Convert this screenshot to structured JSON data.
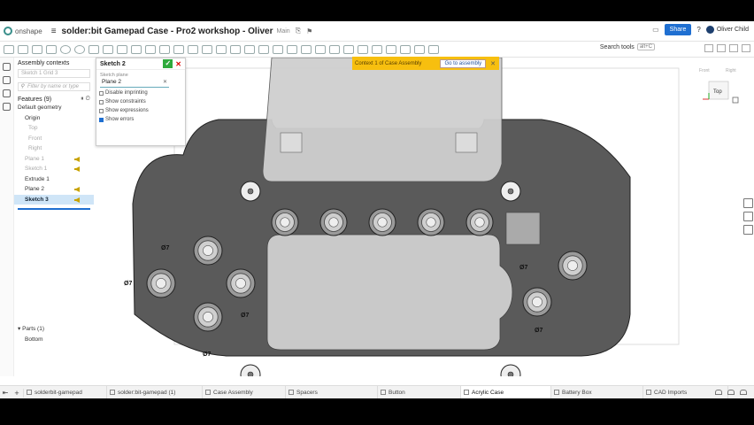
{
  "app": {
    "logo_text": "onshape",
    "title": "solder:bit Gamepad Case - Pro2 workshop - Oliver",
    "branch": "Main"
  },
  "header": {
    "share_label": "Share",
    "help_label": "?",
    "user_name": "Oliver Child"
  },
  "toolbar": {
    "search_tools_label": "Search tools",
    "search_tools_shortcut": "alt+C"
  },
  "feature_panel": {
    "assembly_contexts_title": "Assembly contexts",
    "assembly_context_value": "Sketch 1  Grid 3",
    "filter_placeholder": "Filter by name or type",
    "features_label": "Features (9)",
    "items": [
      {
        "label": "Default geometry",
        "indent": 0,
        "state": "normal",
        "arrow": false
      },
      {
        "label": "Origin",
        "indent": 1,
        "state": "normal",
        "arrow": false
      },
      {
        "label": "Top",
        "indent": 2,
        "state": "dim",
        "arrow": false
      },
      {
        "label": "Front",
        "indent": 2,
        "state": "dim",
        "arrow": false
      },
      {
        "label": "Right",
        "indent": 2,
        "state": "dim",
        "arrow": false
      },
      {
        "label": "Plane 1",
        "indent": 1,
        "state": "dim",
        "arrow": true
      },
      {
        "label": "Sketch 1",
        "indent": 1,
        "state": "dim",
        "arrow": true
      },
      {
        "label": "Extrude 1",
        "indent": 1,
        "state": "normal",
        "arrow": false
      },
      {
        "label": "Plane 2",
        "indent": 1,
        "state": "normal",
        "arrow": true
      },
      {
        "label": "Sketch 3",
        "indent": 1,
        "state": "selected",
        "arrow": true
      }
    ],
    "parts_label": "Parts (1)",
    "parts": [
      "Bottom"
    ]
  },
  "sketch_dialog": {
    "title": "Sketch 2",
    "plane_label": "Sketch plane",
    "plane_value": "Plane 2",
    "checkboxes": [
      {
        "label": "Disable imprinting",
        "checked": false
      },
      {
        "label": "Show constraints",
        "checked": false
      },
      {
        "label": "Show expressions",
        "checked": false
      },
      {
        "label": "Show errors",
        "checked": true
      }
    ]
  },
  "context_banner": {
    "text": "Context 1 of Case Assembly",
    "button_label": "Go to assembly",
    "color": "#f7bf0f"
  },
  "view_cube": {
    "face_label": "Top",
    "front_label": "Front",
    "right_label": "Right"
  },
  "drawing": {
    "dimension_label": "Ø7",
    "accent_fill": "#5a5a5a",
    "board_fill": "#cfcfcf"
  },
  "tabs": [
    {
      "label": "solderbit-gamepad",
      "active": false
    },
    {
      "label": "solder:bit-gamepad (1)",
      "active": false
    },
    {
      "label": "Case Assembly",
      "active": false
    },
    {
      "label": "Spacers",
      "active": false
    },
    {
      "label": "Button",
      "active": false
    },
    {
      "label": "Acrylic Case",
      "active": true
    },
    {
      "label": "Battery Box",
      "active": false
    },
    {
      "label": "CAD Imports",
      "active": false
    }
  ],
  "colors": {
    "accent": "#1f6fd1",
    "confirm": "#2eaa3c",
    "warning_arrow": "#c8a300",
    "selection": "#cfe5f7"
  }
}
